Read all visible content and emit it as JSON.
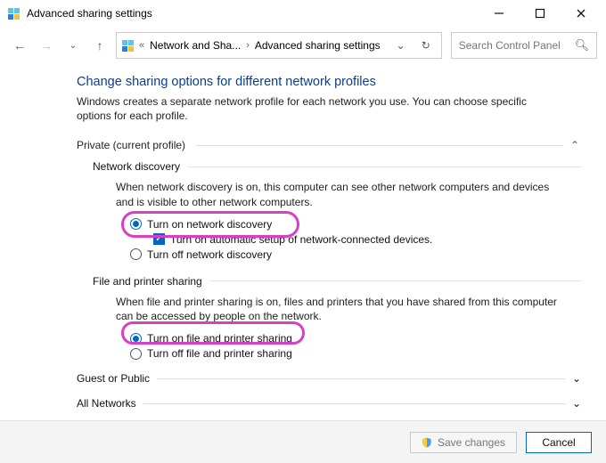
{
  "window": {
    "title": "Advanced sharing settings"
  },
  "nav": {
    "crumb1": "Network and Sha...",
    "crumb2": "Advanced sharing settings"
  },
  "search": {
    "placeholder": "Search Control Panel"
  },
  "page": {
    "title": "Change sharing options for different network profiles",
    "desc": "Windows creates a separate network profile for each network you use. You can choose specific options for each profile."
  },
  "sections": {
    "private": {
      "label": "Private (current profile)",
      "netdisc": {
        "heading": "Network discovery",
        "desc": "When network discovery is on, this computer can see other network computers and devices and is visible to other network computers.",
        "opt_on": "Turn on network discovery",
        "opt_auto": "Turn on automatic setup of network-connected devices.",
        "opt_off": "Turn off network discovery"
      },
      "fps": {
        "heading": "File and printer sharing",
        "desc": "When file and printer sharing is on, files and printers that you have shared from this computer can be accessed by people on the network.",
        "opt_on": "Turn on file and printer sharing",
        "opt_off": "Turn off file and printer sharing"
      }
    },
    "guest": {
      "label": "Guest or Public"
    },
    "all": {
      "label": "All Networks"
    }
  },
  "footer": {
    "save": "Save changes",
    "cancel": "Cancel"
  }
}
